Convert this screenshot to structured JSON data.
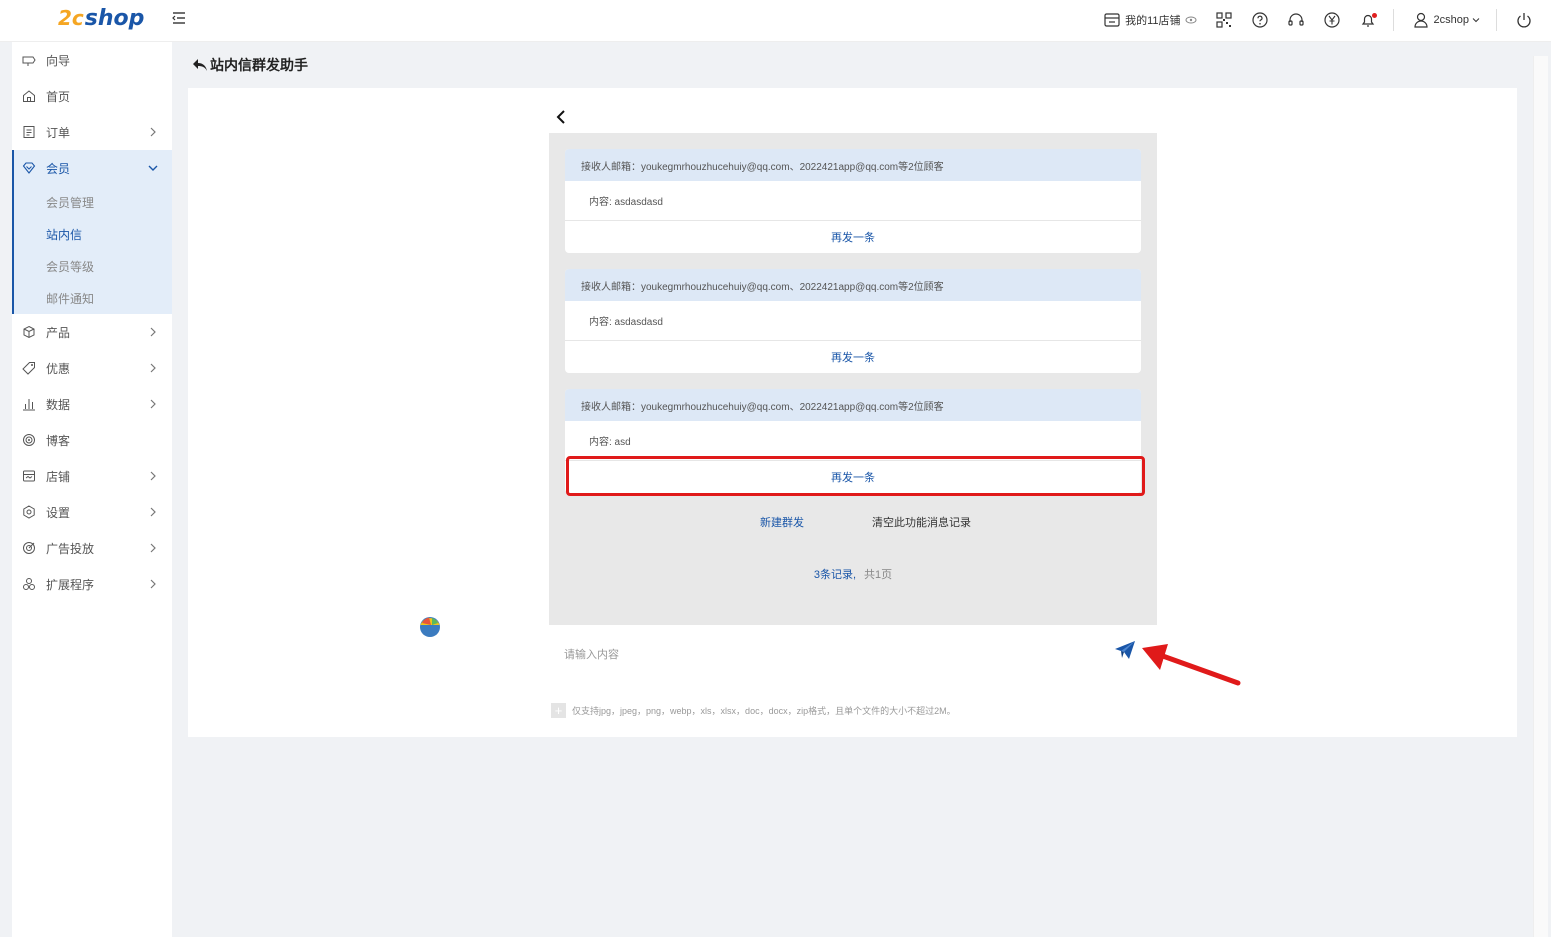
{
  "header": {
    "logo_mark": "2c",
    "logo_word": "shop",
    "store_label": "我的11店铺",
    "user_name": "2cshop",
    "colors": {
      "brand": "#1a56a8",
      "logo_accent": "#f5a623",
      "alert": "#e01a1a"
    }
  },
  "sidebar": {
    "items": [
      {
        "label": "向导",
        "icon": "guide-icon"
      },
      {
        "label": "首页",
        "icon": "home-icon"
      },
      {
        "label": "订单",
        "icon": "order-icon"
      },
      {
        "label": "会员",
        "icon": "member-icon"
      },
      {
        "label": "产品",
        "icon": "product-icon"
      },
      {
        "label": "优惠",
        "icon": "discount-tag-icon"
      },
      {
        "label": "数据",
        "icon": "chart-icon"
      },
      {
        "label": "博客",
        "icon": "blog-icon"
      },
      {
        "label": "店铺",
        "icon": "store-icon"
      },
      {
        "label": "设置",
        "icon": "settings-icon"
      },
      {
        "label": "广告投放",
        "icon": "ads-icon"
      },
      {
        "label": "扩展程序",
        "icon": "extensions-icon"
      }
    ],
    "member_sub": [
      {
        "label": "会员管理"
      },
      {
        "label": "站内信"
      },
      {
        "label": "会员等级"
      },
      {
        "label": "邮件通知"
      }
    ]
  },
  "page": {
    "title": "站内信群发助手"
  },
  "messages": [
    {
      "recipients": "接收人邮箱：youkegmrhouzhucehuiy@qq.com、2022421app@qq.com等2位顾客",
      "content": "内容: asdasdasd",
      "resend": "再发一条"
    },
    {
      "recipients": "接收人邮箱：youkegmrhouzhucehuiy@qq.com、2022421app@qq.com等2位顾客",
      "content": "内容: asdasdasd",
      "resend": "再发一条"
    },
    {
      "recipients": "接收人邮箱：youkegmrhouzhucehuiy@qq.com、2022421app@qq.com等2位顾客",
      "content": "内容: asd",
      "resend": "再发一条"
    }
  ],
  "actions": {
    "new_group": "新建群发",
    "clear_log": "清空此功能消息记录"
  },
  "pagination": {
    "count": "3条记录,",
    "pages": "共1页"
  },
  "composer": {
    "placeholder": "请输入内容",
    "upload_hint": "仅支持jpg，jpeg，png，webp，xls，xlsx，doc，docx，zip格式，且单个文件的大小不超过2M。"
  }
}
